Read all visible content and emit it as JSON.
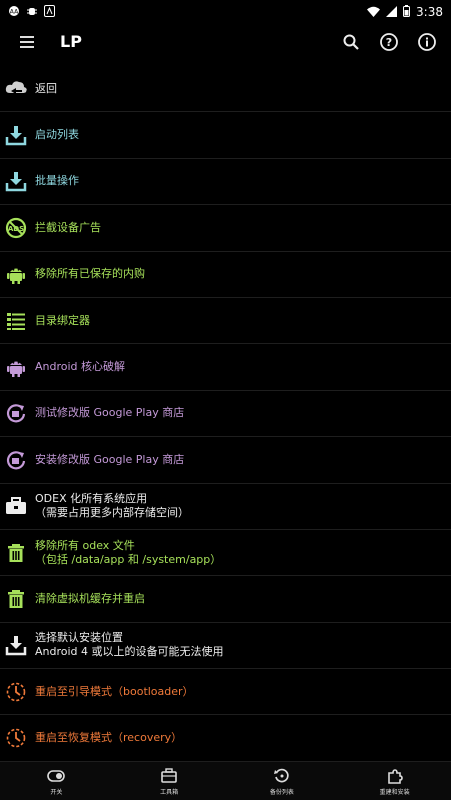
{
  "status": {
    "time": "3:38"
  },
  "appbar": {
    "title": "LP"
  },
  "colors": {
    "cyan": "#8fd8e0",
    "green": "#a6e05a",
    "purple": "#c49ad8",
    "orange": "#f07a3a"
  },
  "menu": [
    {
      "label": "返回",
      "sub": "",
      "color": "white",
      "icon": "back-cloud-icon"
    },
    {
      "label": "启动列表",
      "sub": "",
      "color": "cyan",
      "icon": "download-icon"
    },
    {
      "label": "批量操作",
      "sub": "",
      "color": "cyan",
      "icon": "download-icon"
    },
    {
      "label": "拦截设备广告",
      "sub": "",
      "color": "green",
      "icon": "ads-block-icon"
    },
    {
      "label": "移除所有已保存的内购",
      "sub": "",
      "color": "green",
      "icon": "android-icon"
    },
    {
      "label": "目录绑定器",
      "sub": "",
      "color": "green",
      "icon": "folder-list-icon"
    },
    {
      "label": "Android 核心破解",
      "sub": "",
      "color": "purple",
      "icon": "android-icon"
    },
    {
      "label": "测试修改版 Google Play 商店",
      "sub": "",
      "color": "purple",
      "icon": "refresh-store-icon"
    },
    {
      "label": "安装修改版 Google Play 商店",
      "sub": "",
      "color": "purple",
      "icon": "refresh-store-icon"
    },
    {
      "label": "ODEX 化所有系统应用",
      "sub": "（需要占用更多内部存储空间）",
      "color": "light",
      "icon": "toolbox-icon"
    },
    {
      "label": "移除所有 odex 文件",
      "sub": "（包括 /data/app 和 /system/app）",
      "color": "green",
      "icon": "trash-icon"
    },
    {
      "label": "清除虚拟机缓存并重启",
      "sub": "",
      "color": "green",
      "icon": "trash-icon"
    },
    {
      "label": "选择默认安装位置",
      "sub": "Android 4 或以上的设备可能无法使用",
      "color": "light",
      "icon": "download-icon"
    },
    {
      "label": "重启至引导模式（bootloader）",
      "sub": "",
      "color": "orange",
      "icon": "reboot-icon"
    },
    {
      "label": "重启至恢复模式（recovery）",
      "sub": "",
      "color": "orange",
      "icon": "reboot-icon"
    }
  ],
  "bottomnav": [
    {
      "label": "开关",
      "icon": "toggle-icon"
    },
    {
      "label": "工具箱",
      "icon": "toolbox-icon"
    },
    {
      "label": "备份列表",
      "icon": "backup-icon"
    },
    {
      "label": "重建和安装",
      "icon": "puzzle-icon"
    }
  ]
}
